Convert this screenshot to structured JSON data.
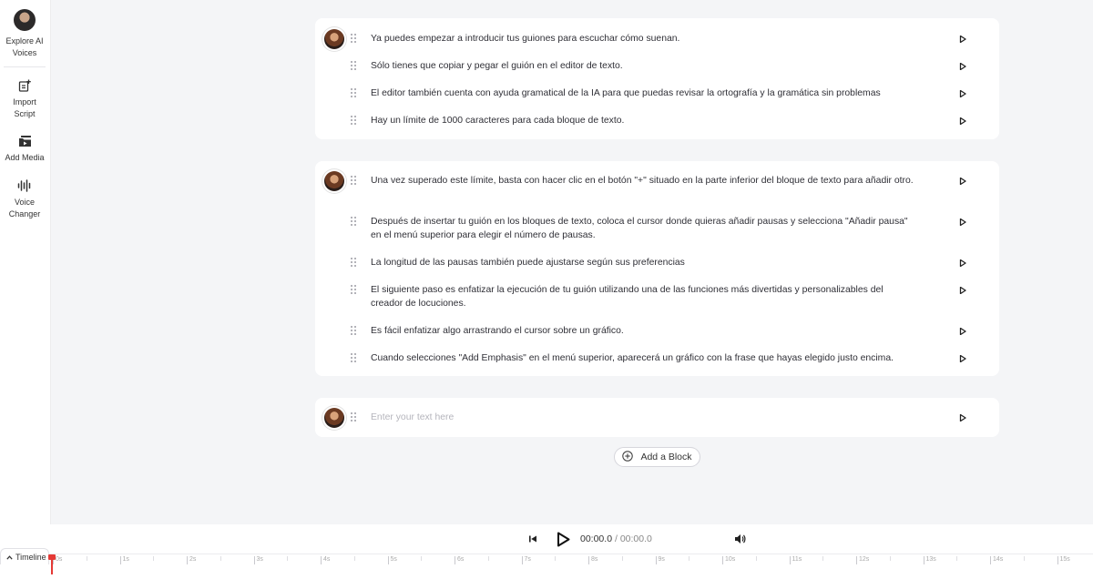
{
  "sidebar": {
    "items": [
      {
        "label_line1": "Explore AI",
        "label_line2": "Voices",
        "icon": "avatar"
      },
      {
        "label_line1": "Import",
        "label_line2": "Script",
        "icon": "import-icon"
      },
      {
        "label_line1": "Add Media",
        "label_line2": "",
        "icon": "media-icon"
      },
      {
        "label_line1": "Voice",
        "label_line2": "Changer",
        "icon": "voice-changer-icon"
      }
    ]
  },
  "blocks": [
    {
      "lines": [
        "Ya puedes empezar a introducir tus guiones para escuchar cómo suenan.",
        "Sólo tienes que copiar y pegar el guión en el editor de texto.",
        "El editor también cuenta con ayuda gramatical de la IA para que puedas revisar la ortografía y la gramática sin problemas",
        "Hay un límite de 1000 caracteres para cada bloque de texto."
      ]
    },
    {
      "lines": [
        "Una vez superado este límite, basta con hacer clic en el botón \"+\" situado en la parte inferior del bloque de texto para añadir otro.",
        "Después de insertar tu guión en los bloques de texto, coloca el cursor donde quieras añadir pausas y selecciona \"Añadir pausa\" en el menú superior para elegir el número de pausas.",
        "La longitud de las pausas también puede ajustarse según sus preferencias",
        "El siguiente paso es enfatizar la ejecución de tu guión utilizando una de las funciones más divertidas y personalizables del creador de locuciones.",
        "Es fácil enfatizar algo arrastrando el cursor sobre un gráfico.",
        "Cuando selecciones \"Add Emphasis\" en el menú superior, aparecerá un gráfico con la frase que hayas elegido justo encima."
      ]
    },
    {
      "placeholder": "Enter your text here"
    }
  ],
  "add_block_label": "Add a Block",
  "player": {
    "current_time": "00:00.0",
    "separator": " / ",
    "total_time": "00:00.0"
  },
  "timeline": {
    "label": "Timeline",
    "ticks": [
      "0s",
      "1s",
      "2s",
      "3s",
      "4s",
      "5s",
      "6s",
      "7s",
      "8s",
      "9s",
      "10s",
      "11s",
      "12s",
      "13s",
      "14s",
      "15s"
    ]
  },
  "colors": {
    "accent_playhead": "#e53935",
    "background": "#f4f5f7",
    "card": "#ffffff"
  }
}
